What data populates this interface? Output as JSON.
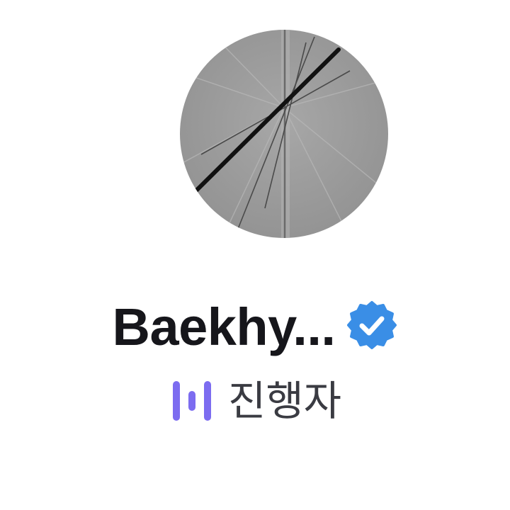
{
  "profile": {
    "name": "Baekhy...",
    "verified_badge": {
      "icon": "verified-badge-icon",
      "color": "#3a8ee6",
      "check_color": "#ffffff"
    },
    "role_label": "진행자",
    "role_icon": {
      "icon": "audio-bars-icon",
      "color": "#7c6cf0"
    },
    "avatar": {
      "icon": "avatar-image",
      "background": "#9a9a9a"
    }
  }
}
